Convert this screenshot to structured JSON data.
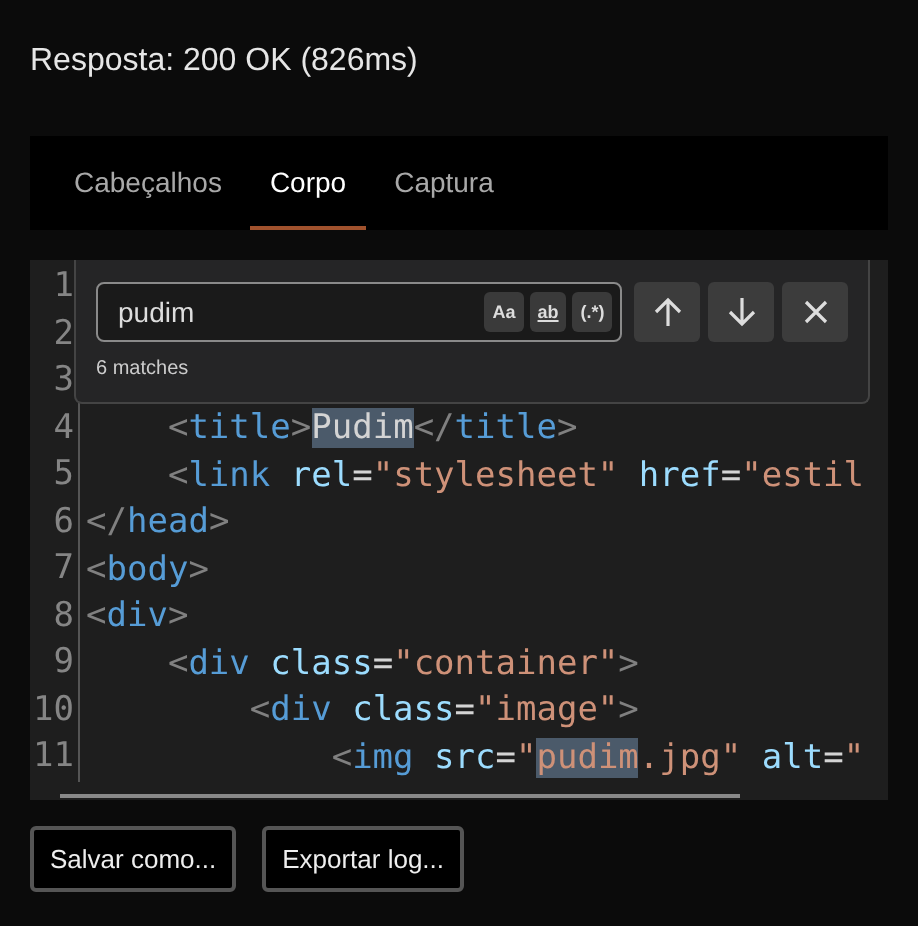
{
  "title": "Resposta: 200 OK (826ms)",
  "tabs": [
    {
      "label": "Cabeçalhos",
      "selected": false
    },
    {
      "label": "Corpo",
      "selected": true
    },
    {
      "label": "Captura",
      "selected": false
    }
  ],
  "editor": {
    "lines": [
      {
        "number": "1"
      },
      {
        "number": "2"
      },
      {
        "number": "3"
      },
      {
        "number": "4",
        "tokens": [
          {
            "kind": "punct",
            "text": "    <"
          },
          {
            "kind": "tag",
            "text": "title"
          },
          {
            "kind": "punct",
            "text": ">"
          },
          {
            "kind": "text",
            "text": "Pudim",
            "highlighted": true
          },
          {
            "kind": "punct",
            "text": "</"
          },
          {
            "kind": "tag",
            "text": "title"
          },
          {
            "kind": "punct",
            "text": ">"
          }
        ]
      },
      {
        "number": "5",
        "tokens": [
          {
            "kind": "punct",
            "text": "    <"
          },
          {
            "kind": "tag",
            "text": "link"
          },
          {
            "kind": "attr",
            "text": " rel"
          },
          {
            "kind": "text",
            "text": "="
          },
          {
            "kind": "string",
            "text": "\"stylesheet\""
          },
          {
            "kind": "attr",
            "text": " href"
          },
          {
            "kind": "text",
            "text": "="
          },
          {
            "kind": "string",
            "text": "\"estil"
          }
        ]
      },
      {
        "number": "6",
        "tokens": [
          {
            "kind": "punct",
            "text": "</"
          },
          {
            "kind": "tag",
            "text": "head"
          },
          {
            "kind": "punct",
            "text": ">"
          }
        ]
      },
      {
        "number": "7",
        "tokens": [
          {
            "kind": "punct",
            "text": "<"
          },
          {
            "kind": "tag",
            "text": "body"
          },
          {
            "kind": "punct",
            "text": ">"
          }
        ]
      },
      {
        "number": "8",
        "tokens": [
          {
            "kind": "punct",
            "text": "<"
          },
          {
            "kind": "tag",
            "text": "div"
          },
          {
            "kind": "punct",
            "text": ">"
          }
        ]
      },
      {
        "number": "9",
        "tokens": [
          {
            "kind": "punct",
            "text": "    <"
          },
          {
            "kind": "tag",
            "text": "div"
          },
          {
            "kind": "attr",
            "text": " class"
          },
          {
            "kind": "text",
            "text": "="
          },
          {
            "kind": "string",
            "text": "\"container\""
          },
          {
            "kind": "punct",
            "text": ">"
          }
        ]
      },
      {
        "number": "10",
        "tokens": [
          {
            "kind": "punct",
            "text": "        <"
          },
          {
            "kind": "tag",
            "text": "div"
          },
          {
            "kind": "attr",
            "text": " class"
          },
          {
            "kind": "text",
            "text": "="
          },
          {
            "kind": "string",
            "text": "\"image\""
          },
          {
            "kind": "punct",
            "text": ">"
          }
        ]
      },
      {
        "number": "11",
        "tokens": [
          {
            "kind": "punct",
            "text": "            <"
          },
          {
            "kind": "tag",
            "text": "img"
          },
          {
            "kind": "attr",
            "text": " src"
          },
          {
            "kind": "text",
            "text": "="
          },
          {
            "kind": "string",
            "text": "\""
          },
          {
            "kind": "string",
            "text": "pudim",
            "highlighted": true
          },
          {
            "kind": "string",
            "text": ".jpg\""
          },
          {
            "kind": "attr",
            "text": " alt"
          },
          {
            "kind": "text",
            "text": "="
          },
          {
            "kind": "string",
            "text": "\""
          }
        ]
      }
    ],
    "find": {
      "value": "pudim",
      "options": [
        {
          "label": "Aa",
          "on": false
        },
        {
          "label": "ab",
          "on": false
        },
        {
          "label": "(.*)",
          "on": false
        }
      ],
      "status": "6 matches"
    }
  },
  "buttons": [
    "Salvar como...",
    "Exportar log..."
  ]
}
